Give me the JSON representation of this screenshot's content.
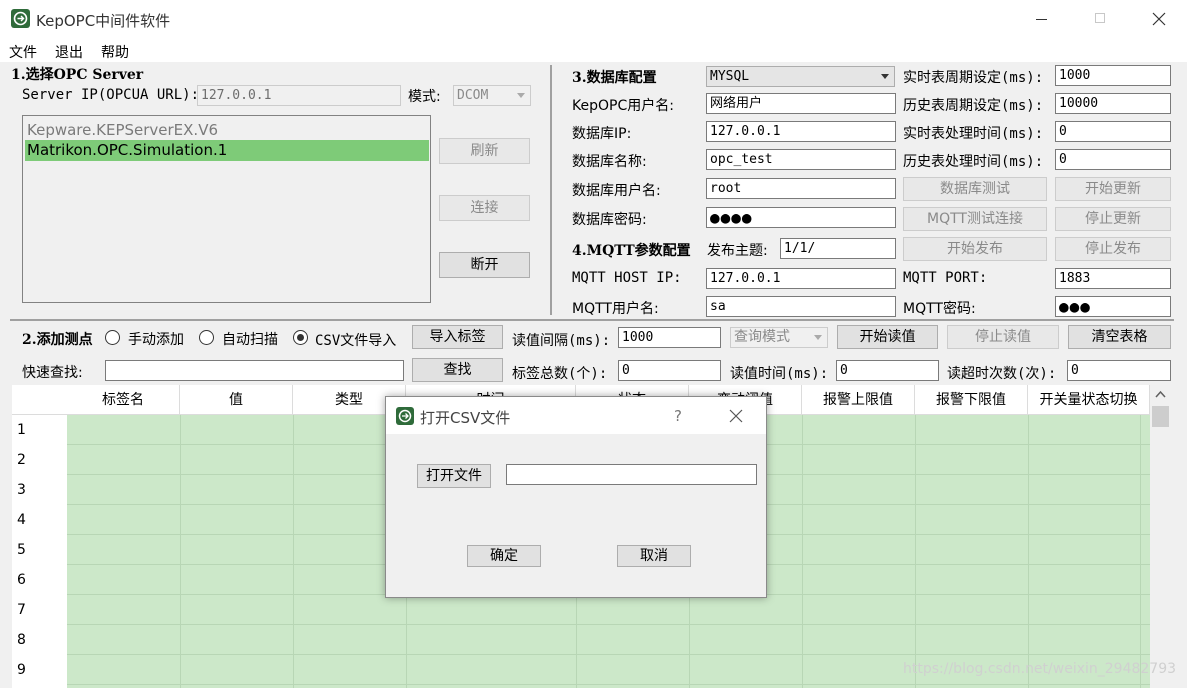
{
  "window": {
    "title": "KepOPC中间件软件"
  },
  "menu": [
    "文件",
    "退出",
    "帮助"
  ],
  "opc": {
    "heading": "1.选择OPC Server",
    "ip_label": "Server IP(OPCUA URL):",
    "ip_value": "127.0.0.1",
    "mode_label": "模式:",
    "mode_value": "DCOM",
    "servers": [
      "Kepware.KEPServerEX.V6",
      "Matrikon.OPC.Simulation.1"
    ],
    "selected_index": 1,
    "refresh": "刷新",
    "connect": "连接",
    "disconnect": "断开"
  },
  "db": {
    "heading": "3.数据库配置",
    "type": "MYSQL",
    "user_label": "KepOPC用户名:",
    "user_value": "网络用户",
    "ip_label": "数据库IP:",
    "ip_value": "127.0.0.1",
    "name_label": "数据库名称:",
    "name_value": "opc_test",
    "dbuser_label": "数据库用户名:",
    "dbuser_value": "root",
    "pwd_label": "数据库密码:",
    "pwd_value": "●●●●",
    "rt_period_label": "实时表周期设定(ms):",
    "rt_period_value": "1000",
    "hist_period_label": "历史表周期设定(ms):",
    "hist_period_value": "10000",
    "rt_proc_label": "实时表处理时间(ms):",
    "rt_proc_value": "0",
    "hist_proc_label": "历史表处理时间(ms):",
    "hist_proc_value": "0",
    "test_btn": "数据库测试",
    "start_update": "开始更新",
    "mqtt_test": "MQTT测试连接",
    "stop_update": "停止更新"
  },
  "mqtt": {
    "heading": "4.MQTT参数配置",
    "topic_label": "发布主题:",
    "topic_value": "1/1/",
    "start_pub": "开始发布",
    "stop_pub": "停止发布",
    "host_label": "MQTT HOST IP:",
    "host_value": "127.0.0.1",
    "port_label": "MQTT PORT:",
    "port_value": "1883",
    "user_label": "MQTT用户名:",
    "user_value": "sa",
    "pwd_label": "MQTT密码:",
    "pwd_value": "●●●"
  },
  "points": {
    "heading": "2.添加测点",
    "manual": "手动添加",
    "auto": "自动扫描",
    "csv": "CSV文件导入",
    "import_btn": "导入标签",
    "interval_label": "读值间隔(ms):",
    "interval_value": "1000",
    "query_mode": "查询模式",
    "start_read": "开始读值",
    "stop_read": "停止读值",
    "clear": "清空表格",
    "search_label": "快速查找:",
    "search_value": "",
    "search_btn": "查找",
    "total_label": "标签总数(个):",
    "total_value": "0",
    "read_time_label": "读值时间(ms):",
    "read_time_value": "0",
    "timeout_label": "读超时次数(次):",
    "timeout_value": "0"
  },
  "table": {
    "columns": [
      "标签名",
      "值",
      "类型",
      "时间",
      "状态",
      "变动阈值",
      "报警上限值",
      "报警下限值",
      "开关量状态切换"
    ],
    "rows": [
      "1",
      "2",
      "3",
      "4",
      "5",
      "6",
      "7",
      "8",
      "9"
    ]
  },
  "dialog": {
    "title": "打开CSV文件",
    "help": "?",
    "open_btn": "打开文件",
    "path_value": "",
    "ok": "确定",
    "cancel": "取消"
  },
  "watermark": "https://blog.csdn.net/weixin_29482793"
}
